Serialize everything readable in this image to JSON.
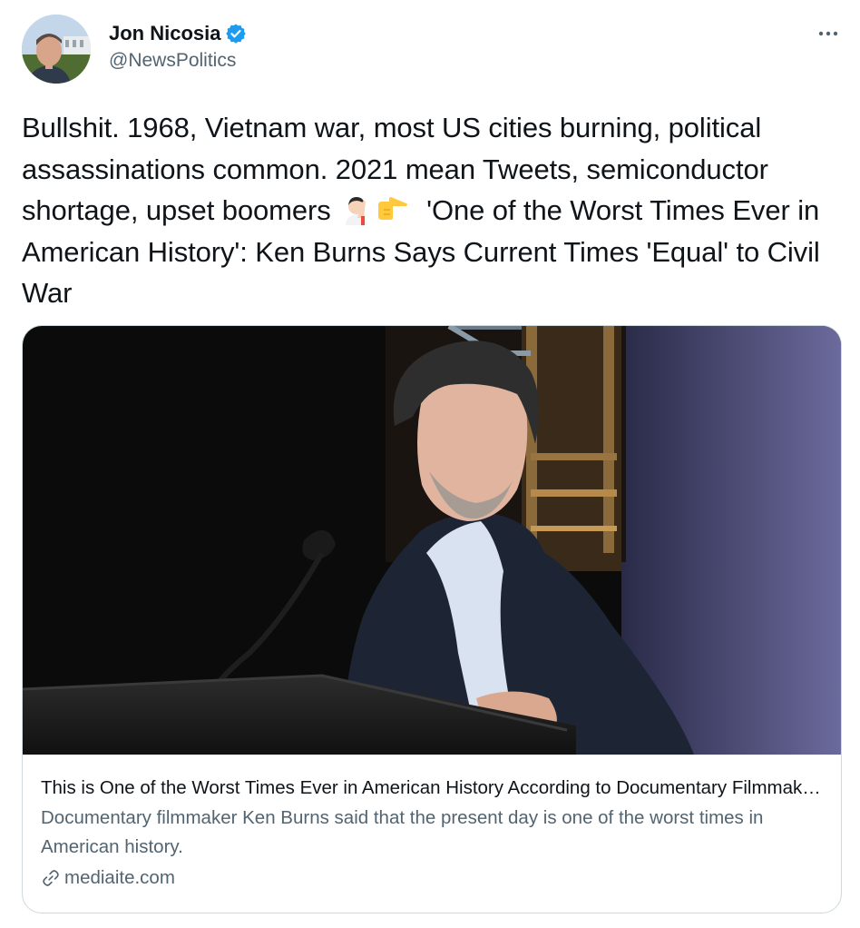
{
  "author": {
    "display_name": "Jon Nicosia",
    "handle": "@NewsPolitics",
    "verified_icon": "verified-badge-icon",
    "avatar_icon": "avatar"
  },
  "tweet": {
    "text_before_emoji": "Bullshit. 1968, Vietnam war, most US cities burning, political assassinations common. 2021 mean Tweets, semiconductor shortage, upset boomers",
    "emojis": [
      "facepalm-emoji",
      "pointing-right-emoji"
    ],
    "text_after_emoji": "  'One of the Worst Times Ever in American History': Ken Burns Says Current Times 'Equal' to Civil War"
  },
  "card": {
    "image_icon": "card-image",
    "title": "This is One of the Worst Times Ever in American History According to Documentary Filmmaker Ken Burns",
    "description": "Documentary filmmaker Ken Burns said that the present day is one of the worst times in American history.",
    "domain": "mediaite.com",
    "link_icon": "link-icon"
  },
  "colors": {
    "text_primary": "#0f1419",
    "text_secondary": "#536471",
    "verified_blue": "#1d9bf0",
    "border": "#cfd9de"
  }
}
